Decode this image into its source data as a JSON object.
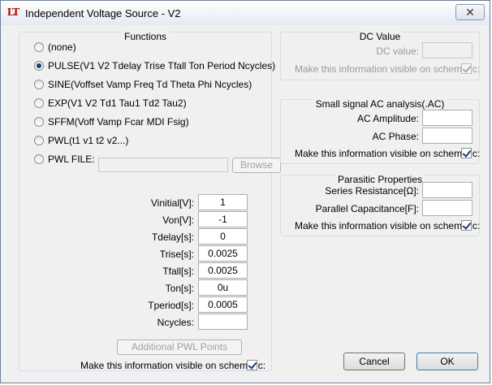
{
  "window": {
    "title": "Independent Voltage Source - V2",
    "close_glyph": "✕",
    "app_icon_text": "LT"
  },
  "functions": {
    "title": "Functions",
    "options": [
      {
        "label": "(none)",
        "selected": false
      },
      {
        "label": "PULSE(V1 V2 Tdelay Trise Tfall Ton Period Ncycles)",
        "selected": true
      },
      {
        "label": "SINE(Voffset Vamp Freq Td Theta Phi Ncycles)",
        "selected": false
      },
      {
        "label": "EXP(V1 V2 Td1 Tau1 Td2 Tau2)",
        "selected": false
      },
      {
        "label": "SFFM(Voff Vamp Fcar MDI Fsig)",
        "selected": false
      },
      {
        "label": "PWL(t1 v1 t2 v2...)",
        "selected": false
      },
      {
        "label": "PWL FILE:",
        "selected": false
      }
    ],
    "pwl_file_value": "",
    "browse_label": "Browse",
    "params": [
      {
        "label": "Vinitial[V]:",
        "value": "1"
      },
      {
        "label": "Von[V]:",
        "value": "-1"
      },
      {
        "label": "Tdelay[s]:",
        "value": "0"
      },
      {
        "label": "Trise[s]:",
        "value": "0.0025"
      },
      {
        "label": "Tfall[s]:",
        "value": "0.0025"
      },
      {
        "label": "Ton[s]:",
        "value": "0u"
      },
      {
        "label": "Tperiod[s]:",
        "value": "0.0005"
      },
      {
        "label": "Ncycles:",
        "value": ""
      }
    ],
    "additional_pwl_label": "Additional PWL Points",
    "visible_label": "Make this information visible on schematic:",
    "visible_checked": true
  },
  "dc": {
    "title": "DC Value",
    "value_label": "DC value:",
    "value": "",
    "visible_label": "Make this information visible on schematic:",
    "visible_checked": true
  },
  "ac": {
    "title": "Small signal AC analysis(.AC)",
    "amplitude_label": "AC Amplitude:",
    "amplitude_value": "",
    "phase_label": "AC Phase:",
    "phase_value": "",
    "visible_label": "Make this information visible on schematic:",
    "visible_checked": true
  },
  "parasitic": {
    "title": "Parasitic Properties",
    "series_label": "Series Resistance[Ω]:",
    "series_value": "",
    "parallel_label": "Parallel Capacitance[F]:",
    "parallel_value": "",
    "visible_label": "Make this information visible on schematic:",
    "visible_checked": true
  },
  "buttons": {
    "cancel": "Cancel",
    "ok": "OK"
  }
}
